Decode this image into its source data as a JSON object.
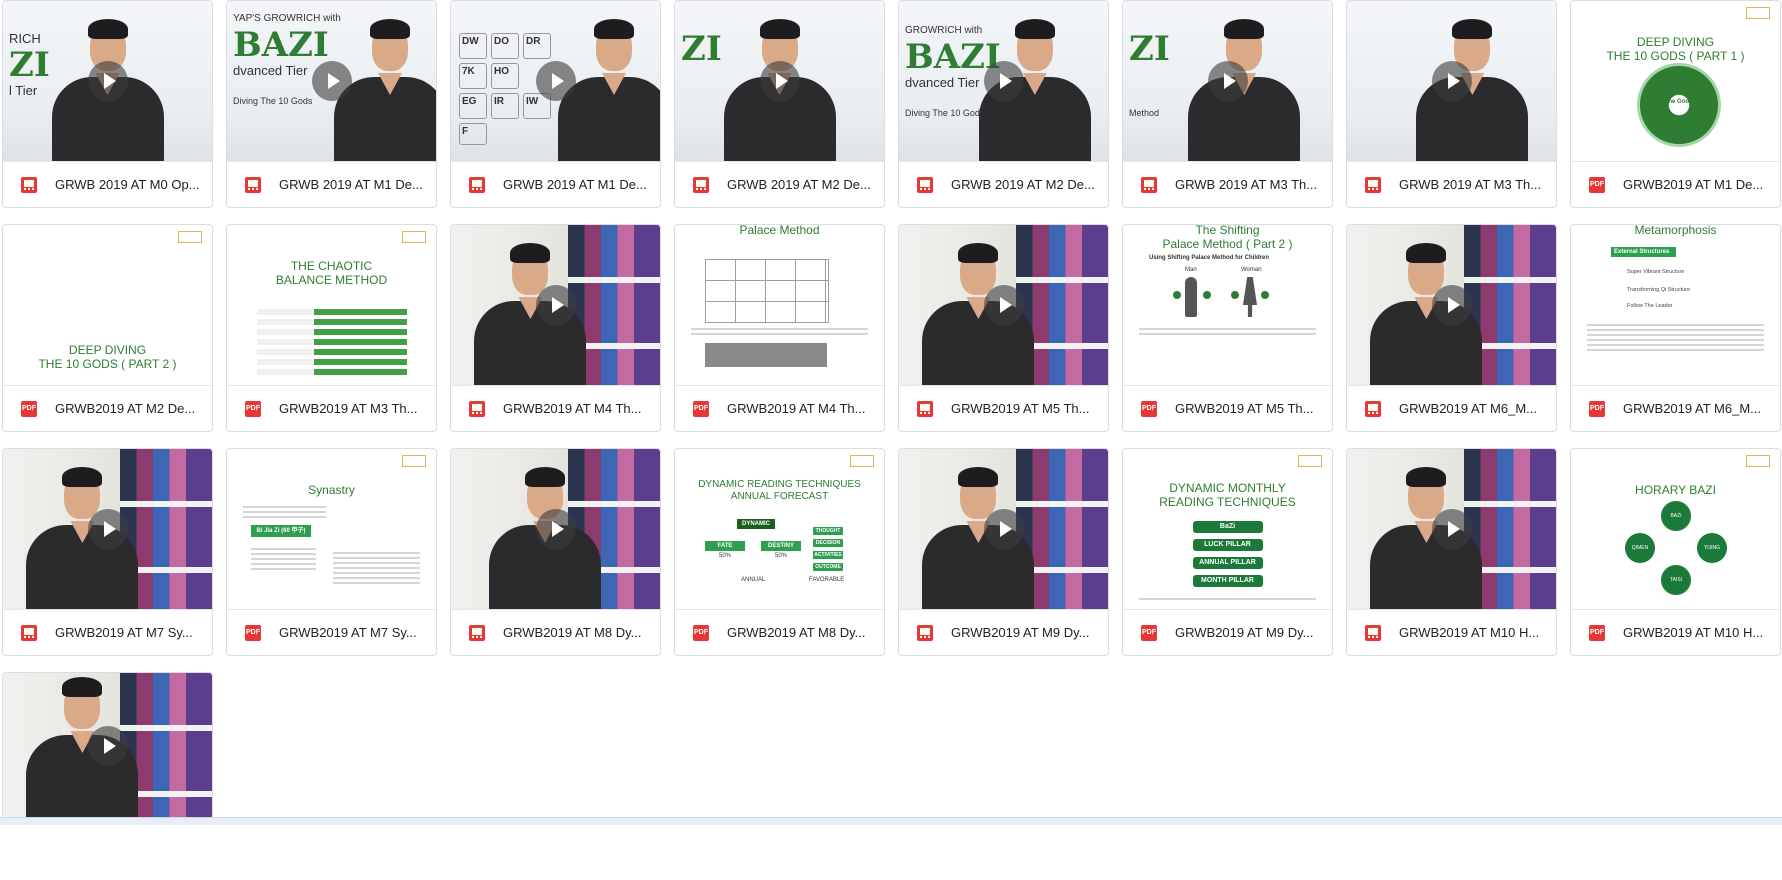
{
  "files": [
    {
      "name": "GRWB 2019 AT M0 Op...",
      "type": "video"
    },
    {
      "name": "GRWB 2019 AT M1 De...",
      "type": "video"
    },
    {
      "name": "GRWB 2019 AT M1 De...",
      "type": "video"
    },
    {
      "name": "GRWB 2019 AT M2 De...",
      "type": "video"
    },
    {
      "name": "GRWB 2019 AT M2 De...",
      "type": "video"
    },
    {
      "name": "GRWB 2019 AT M3 Th...",
      "type": "video"
    },
    {
      "name": "GRWB 2019 AT M3 Th...",
      "type": "video"
    },
    {
      "name": "GRWB2019 AT M1 De...",
      "type": "pdf"
    },
    {
      "name": "GRWB2019 AT M2 De...",
      "type": "pdf"
    },
    {
      "name": "GRWB2019 AT M3 Th...",
      "type": "pdf"
    },
    {
      "name": "GRWB2019 AT M4 Th...",
      "type": "video"
    },
    {
      "name": "GRWB2019 AT M4 Th...",
      "type": "pdf"
    },
    {
      "name": "GRWB2019 AT M5 Th...",
      "type": "video"
    },
    {
      "name": "GRWB2019 AT M5 Th...",
      "type": "pdf"
    },
    {
      "name": "GRWB2019 AT M6_M...",
      "type": "video"
    },
    {
      "name": "GRWB2019 AT M6_M...",
      "type": "pdf"
    },
    {
      "name": "GRWB2019 AT M7 Sy...",
      "type": "video"
    },
    {
      "name": "GRWB2019 AT M7 Sy...",
      "type": "pdf"
    },
    {
      "name": "GRWB2019 AT M8 Dy...",
      "type": "video"
    },
    {
      "name": "GRWB2019 AT M8 Dy...",
      "type": "pdf"
    },
    {
      "name": "GRWB2019 AT M9 Dy...",
      "type": "video"
    },
    {
      "name": "GRWB2019 AT M9 Dy...",
      "type": "pdf"
    },
    {
      "name": "GRWB2019 AT M10 H...",
      "type": "video"
    },
    {
      "name": "GRWB2019 AT M10 H...",
      "type": "pdf"
    },
    {
      "name": "",
      "type": "video"
    }
  ],
  "thumbs": {
    "t1": {
      "brand_top": "RICH",
      "brand_big": "ZI",
      "brand_sub": "l Tier"
    },
    "t2": {
      "brand_top": "YAP'S GROWRICH with",
      "brand_big": "BAZI",
      "brand_sub": "dvanced Tier",
      "foot": "Diving The 10 Gods"
    },
    "t3": {
      "cells": [
        "DW",
        "DO",
        "DR",
        "7K",
        "HO",
        "EG",
        "IR",
        "IW",
        "F"
      ]
    },
    "t4": {
      "brand_big": "ZI"
    },
    "t5": {
      "brand_top": "GROWRICH with",
      "brand_big": "BAZI",
      "brand_sub": "dvanced Tier",
      "foot": "Diving The 10 Gods"
    },
    "t6": {
      "brand_big": "ZI",
      "brand_sub": "Method"
    },
    "t8": {
      "title1": "DEEP DIVING",
      "title2": "THE 10 GODS ( PART 1 )",
      "wheel_center": "The Gods"
    },
    "t9": {
      "title1": "DEEP DIVING",
      "title2": "THE 10 GODS ( PART 2 )"
    },
    "t10": {
      "title1": "THE CHAOTIC",
      "title2": "BALANCE METHOD"
    },
    "t12": {
      "title1": "Palace Method"
    },
    "t14": {
      "title1": "The Shifting",
      "title2": "Palace Method ( Part 2 )",
      "sub": "Using Shifting Palace Method for Children",
      "man": "Man",
      "woman": "Woman"
    },
    "t16": {
      "title1": "Metamorphosis",
      "box": "External Structures 外格",
      "items": [
        "Super Vibrant Structure",
        "Transforming Qi Structure",
        "Follow The Leader"
      ]
    },
    "t18": {
      "title1": "Synastry",
      "box": "Bi Jia Zi (60 甲子)"
    },
    "t20": {
      "title1": "DYNAMIC READING TECHNIQUES",
      "title2": "ANNUAL FORECAST",
      "dynamic": "DYNAMIC",
      "fate": "FATE",
      "destiny": "DESTINY",
      "p1": "50%",
      "p2": "50%",
      "annual": "ANNUAL",
      "favorable": "FAVORABLE",
      "side": [
        "THOUGHT",
        "DECISION",
        "ACTIVITIES",
        "OUTCOME"
      ]
    },
    "t22": {
      "title1": "DYNAMIC MONTHLY",
      "title2": "READING TECHNIQUES",
      "pills": [
        "BaZi",
        "LUCK PILLAR",
        "ANNUAL PILLAR",
        "MONTH PILLAR"
      ]
    },
    "t24": {
      "title1": "HORARY BAZI",
      "c1": "BAZI HORARY",
      "c2": "QIMEN FORECASTING",
      "c3": "YIJING DIVINATION",
      "c4": "TAISI ORACLE"
    }
  }
}
